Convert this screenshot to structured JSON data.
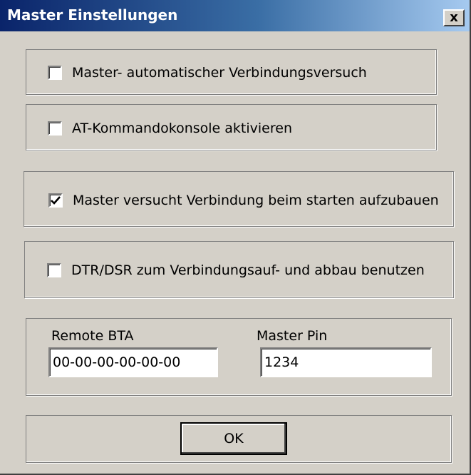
{
  "window": {
    "title": "Master Einstellungen",
    "close_label": "x"
  },
  "options": [
    {
      "label": "Master- automatischer Verbindungsversuch",
      "checked": false
    },
    {
      "label": "AT-Kommandokonsole aktivieren",
      "checked": false
    },
    {
      "label": "Master versucht Verbindung beim starten aufzubauen",
      "checked": true
    },
    {
      "label": "DTR/DSR zum Verbindungsauf- und abbau benutzen",
      "checked": false
    }
  ],
  "fields": {
    "remote_bta": {
      "label": "Remote BTA",
      "value": "00-00-00-00-00-00"
    },
    "master_pin": {
      "label": "Master Pin",
      "value": "1234"
    }
  },
  "buttons": {
    "ok_label": "OK"
  },
  "colors": {
    "face": "#d4d0c8",
    "title_start": "#0a246a",
    "title_end": "#a6caf0"
  }
}
